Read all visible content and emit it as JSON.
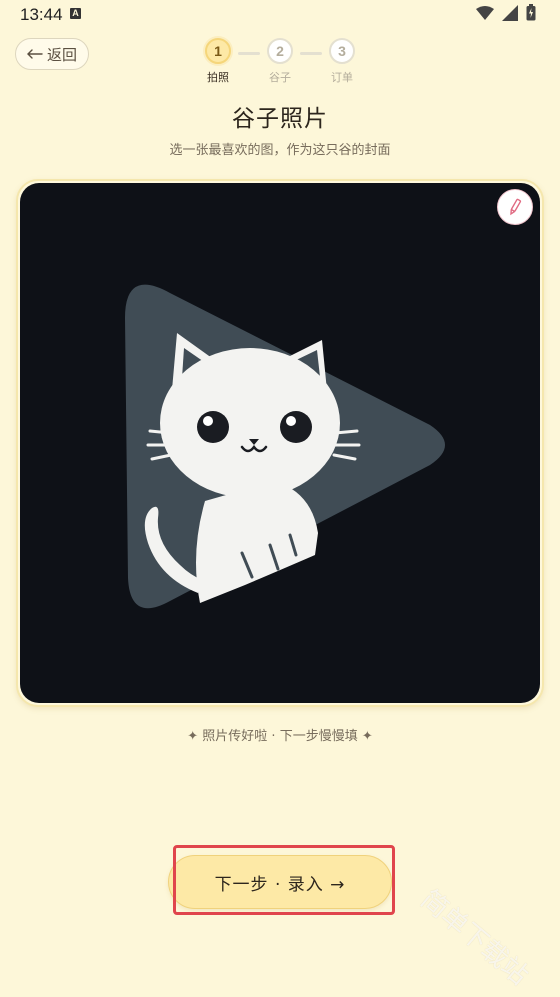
{
  "status_bar": {
    "time": "13:44",
    "notification_icon": "A"
  },
  "header": {
    "back_label": "返回"
  },
  "stepper": {
    "steps": [
      {
        "number": "1",
        "label": "拍照"
      },
      {
        "number": "2",
        "label": "谷子"
      },
      {
        "number": "3",
        "label": "订单"
      }
    ],
    "current_step": 1
  },
  "page": {
    "title": "谷子照片",
    "subtitle": "选一张最喜欢的图，作为这只谷的封面",
    "caption": "✦ 照片传好啦 · 下一步慢慢填 ✦"
  },
  "actions": {
    "next_label": "下一步 · 录入 →"
  },
  "watermark": "简单下载站",
  "colors": {
    "background": "#fdf7d9",
    "accent": "#fde9a6",
    "highlight": "#e0454c"
  }
}
